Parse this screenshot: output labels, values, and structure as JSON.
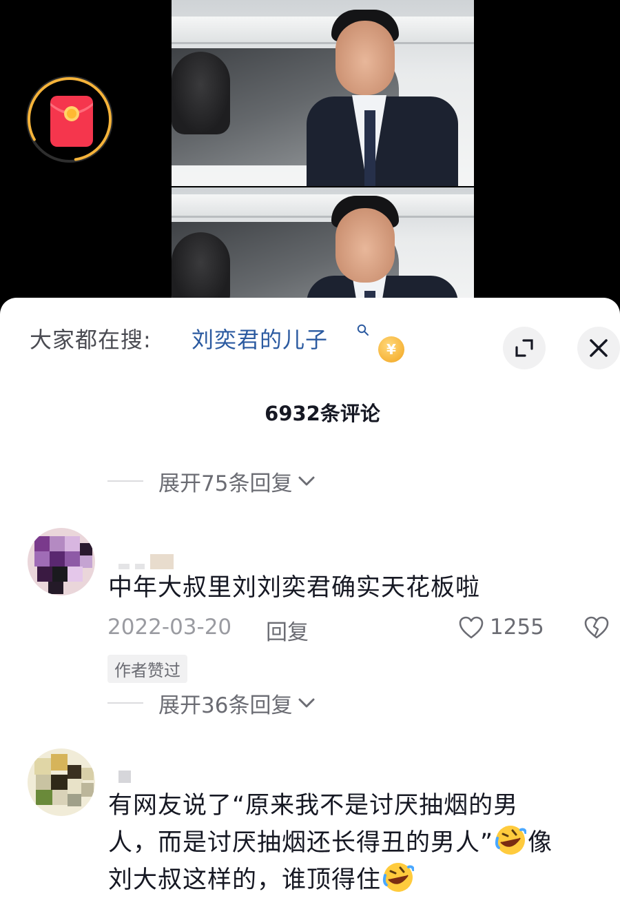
{
  "comments_header": {
    "search_prefix": "大家都在搜:",
    "search_term": "刘奕君的儿子",
    "coin_symbol": "¥",
    "count_label": "6932条评论"
  },
  "top_expand": {
    "label": "展开75条回复"
  },
  "comments": [
    {
      "text": "中年大叔里刘刘奕君确实天花板啦",
      "date": "2022-03-20",
      "reply_label": "回复",
      "likes": "1255",
      "author_badge": "作者赞过",
      "expand_label": "展开36条回复"
    },
    {
      "text_line1": "有网友说了“原来我不是讨厌抽烟的男",
      "text_line2a": "人，而是讨厌抽烟还长得丑的男人”",
      "text_line2b": "像",
      "text_line3": "刘大叔这样的，谁顶得住",
      "emoji": "rofl-emoji"
    }
  ],
  "colors": {
    "accent_link": "#2b5aa0",
    "redpacket": "#f5364d",
    "ring": "#f5b33a"
  },
  "icons": [
    "redpacket-icon",
    "search-icon",
    "coin-icon",
    "expand-icon",
    "close-icon",
    "chevron-down-icon",
    "heart-icon",
    "broken-heart-icon"
  ]
}
